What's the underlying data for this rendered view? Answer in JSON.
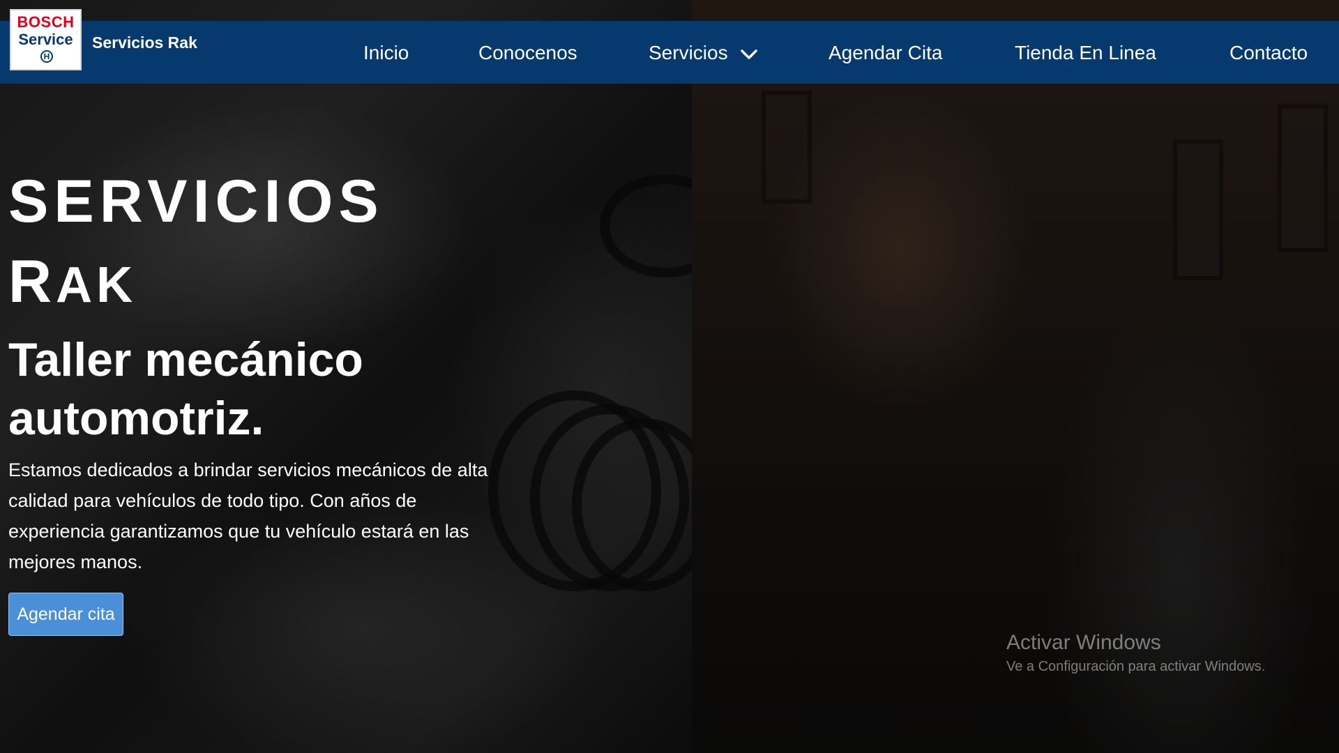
{
  "brand": {
    "logo_line1": "BOSCH",
    "logo_line2": "Service",
    "name": "Servicios Rak"
  },
  "nav": {
    "items": [
      {
        "label": "Inicio"
      },
      {
        "label": "Conocenos"
      },
      {
        "label": "Servicios",
        "icon": "chevron-down-icon"
      },
      {
        "label": "Agendar Cita"
      },
      {
        "label": "Tienda En Linea"
      },
      {
        "label": "Contacto"
      }
    ]
  },
  "hero": {
    "title_line1": "SERVICIOS",
    "title_line2_initial": "R",
    "title_line2_rest": "AK",
    "subtitle": "Taller mecánico automotriz.",
    "description": "Estamos dedicados a brindar servicios mecánicos de alta calidad para vehículos de todo tipo. Con años de experiencia garantizamos que tu vehículo estará en las mejores manos.",
    "cta_label": "Agendar cita"
  },
  "watermark": {
    "title": "Activar Windows",
    "subtitle": "Ve a Configuración para activar Windows."
  },
  "colors": {
    "navbar": "#063a6e",
    "cta": "#4a90d9",
    "logo_red": "#e3001b"
  }
}
